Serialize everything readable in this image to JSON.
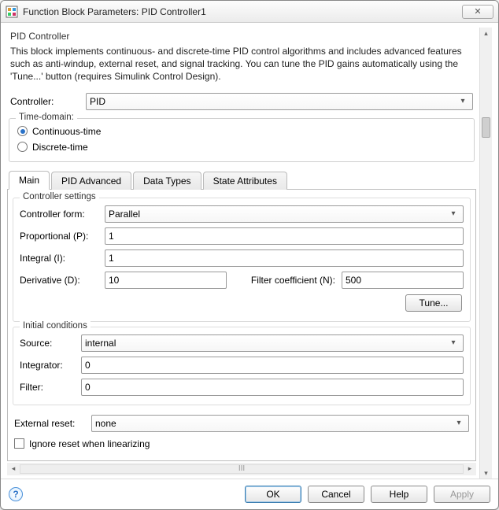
{
  "window": {
    "title": "Function Block Parameters: PID Controller1",
    "close_glyph": "✕"
  },
  "header": {
    "section_title": "PID Controller",
    "description": "This block implements continuous- and discrete-time PID control algorithms and includes advanced features such as anti-windup, external reset, and signal tracking. You can tune the PID gains automatically using the 'Tune...' button (requires Simulink Control Design)."
  },
  "controller": {
    "label": "Controller:",
    "value": "PID"
  },
  "time_domain": {
    "legend": "Time-domain:",
    "options": [
      {
        "label": "Continuous-time",
        "checked": true
      },
      {
        "label": "Discrete-time",
        "checked": false
      }
    ]
  },
  "tabs": [
    "Main",
    "PID Advanced",
    "Data Types",
    "State Attributes"
  ],
  "controller_settings": {
    "legend": "Controller settings",
    "form_label": "Controller form:",
    "form_value": "Parallel",
    "p_label": "Proportional (P):",
    "p_value": "1",
    "i_label": "Integral (I):",
    "i_value": "1",
    "d_label": "Derivative (D):",
    "d_value": "10",
    "n_label": "Filter coefficient (N):",
    "n_value": "500",
    "tune_label": "Tune..."
  },
  "initial_conditions": {
    "legend": "Initial conditions",
    "source_label": "Source:",
    "source_value": "internal",
    "integrator_label": "Integrator:",
    "integrator_value": "0",
    "filter_label": "Filter:",
    "filter_value": "0"
  },
  "external_reset": {
    "label": "External reset:",
    "value": "none"
  },
  "ignore_reset": {
    "label": "Ignore reset when linearizing"
  },
  "hscroll_marker": "III",
  "footer": {
    "ok": "OK",
    "cancel": "Cancel",
    "help": "Help",
    "apply": "Apply"
  }
}
